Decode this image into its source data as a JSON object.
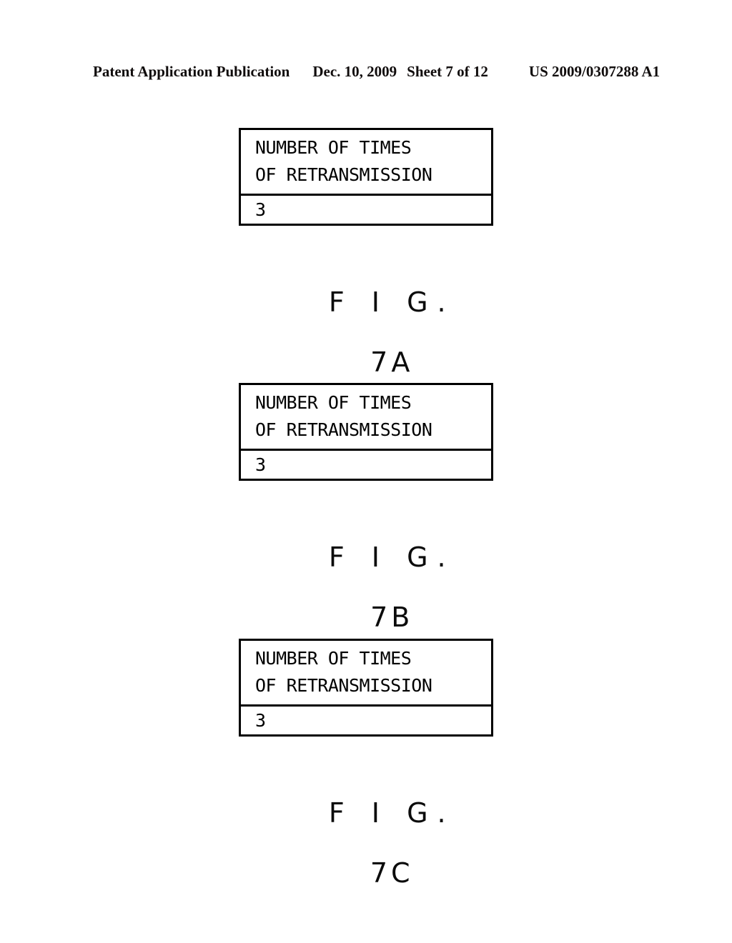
{
  "header": {
    "publication": "Patent Application Publication",
    "date": "Dec. 10, 2009",
    "sheet": "Sheet 7 of 12",
    "doc_number": "US 2009/0307288 A1"
  },
  "colors": {
    "ink": "#000000",
    "page_background": "#ffffff",
    "header_ink": "#100c0c"
  },
  "figures": [
    {
      "caption_prefix": "F I G.",
      "caption_number": "7A",
      "table": {
        "header_lines": [
          "NUMBER OF TIMES",
          "OF RETRANSMISSION"
        ],
        "value": "3"
      }
    },
    {
      "caption_prefix": "F I G.",
      "caption_number": "7B",
      "table": {
        "header_lines": [
          "NUMBER OF TIMES",
          "OF RETRANSMISSION"
        ],
        "value": "3"
      }
    },
    {
      "caption_prefix": "F I G.",
      "caption_number": "7C",
      "table": {
        "header_lines": [
          "NUMBER OF TIMES",
          "OF RETRANSMISSION"
        ],
        "value": "3"
      }
    }
  ]
}
